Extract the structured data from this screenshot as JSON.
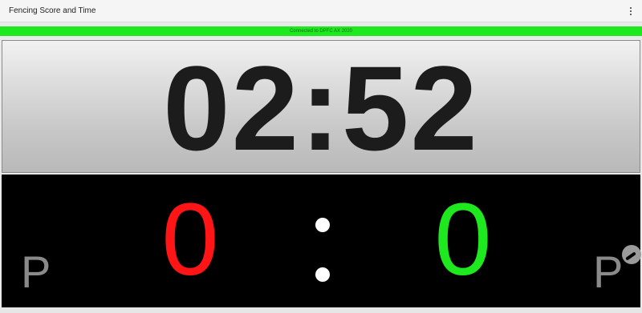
{
  "app": {
    "title": "Fencing Score and Time",
    "menu_icon": "overflow-menu-icon"
  },
  "status": {
    "text": "Connected to DPFC AX 2020",
    "color": "#1ee81e"
  },
  "timer": {
    "value": "02:52"
  },
  "score": {
    "left": "0",
    "right": "0",
    "left_color": "#ff1515",
    "right_color": "#1ee81e",
    "separator": ":"
  },
  "penalty": {
    "left_label": "P",
    "right_label": "P"
  },
  "icons": {
    "settings": "settings-icon"
  }
}
